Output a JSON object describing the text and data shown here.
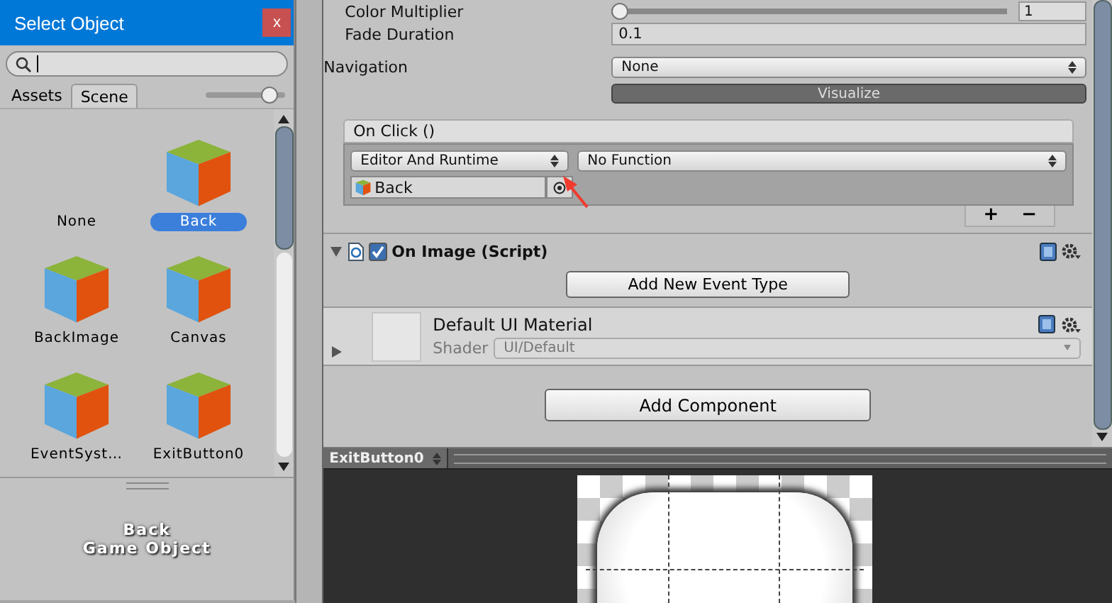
{
  "select_window": {
    "title": "Select Object",
    "close": "x",
    "tabs": [
      {
        "label": "Assets",
        "selected": false
      },
      {
        "label": "Scene",
        "selected": true
      }
    ],
    "zoom_slider": {
      "level": 0.8
    },
    "items": [
      {
        "label": "None",
        "kind": "none",
        "selected": false
      },
      {
        "label": "Back",
        "kind": "object",
        "selected": true
      },
      {
        "label": "BackImage",
        "kind": "object",
        "selected": false
      },
      {
        "label": "Canvas",
        "kind": "object",
        "selected": false
      },
      {
        "label": "EventSyst…",
        "kind": "object",
        "selected": false
      },
      {
        "label": "ExitButton0",
        "kind": "object",
        "selected": false
      }
    ],
    "preview": {
      "name": "Back",
      "type": "Game Object"
    }
  },
  "inspector": {
    "rows": [
      {
        "label": "Color Multiplier",
        "kind": "slider",
        "level": 0,
        "value": "1"
      },
      {
        "label": "Fade Duration",
        "kind": "number",
        "value": "0.1"
      }
    ],
    "navigation": {
      "label": "Navigation",
      "value": "None",
      "button": "Visualize"
    },
    "on_click": {
      "title": "On Click ()",
      "mode": "Editor And Runtime",
      "function": "No Function",
      "target": "Back",
      "add": "+",
      "remove": "−"
    },
    "components": [
      {
        "kind": "script",
        "title": "On Image (Script)",
        "enabled": true,
        "expanded": true,
        "button": "Add New Event Type"
      },
      {
        "kind": "material",
        "title": "Default UI Material",
        "expanded": false,
        "shader_label": "Shader",
        "shader": "UI/Default"
      }
    ],
    "add_component": "Add Component"
  },
  "preview_panel": {
    "tab": "ExitButton0"
  }
}
